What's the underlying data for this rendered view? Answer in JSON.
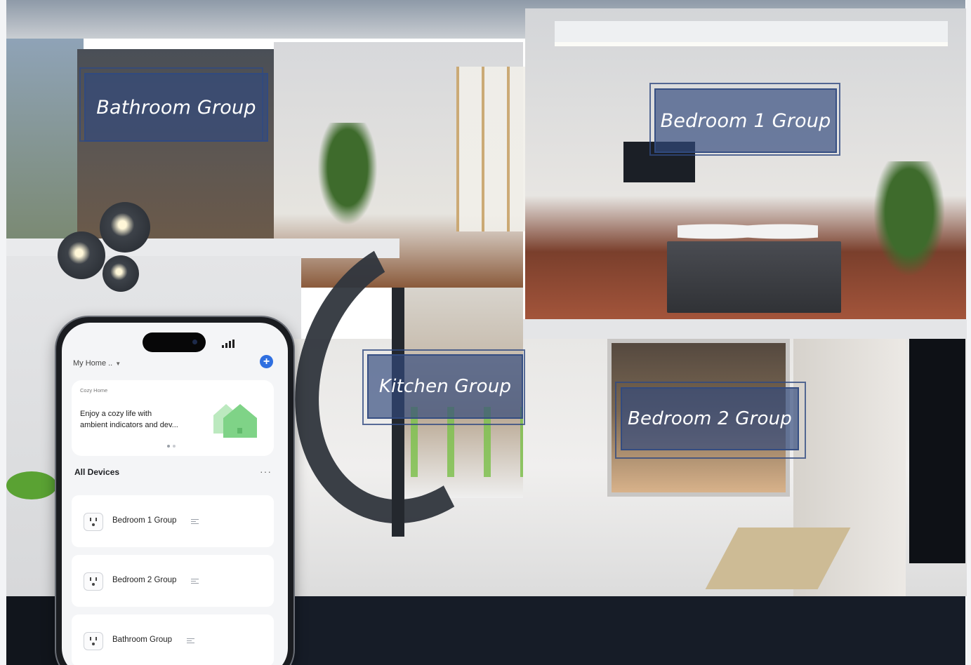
{
  "scene": {
    "labels": {
      "bathroom": "Bathroom Group",
      "bedroom1": "Bedroom 1 Group",
      "kitchen": "Kitchen Group",
      "bedroom2": "Bedroom 2 Group"
    }
  },
  "phone": {
    "home_selector": "My Home ..",
    "add_icon": "plus-circle-icon",
    "banner": {
      "tag": "Cozy Home",
      "text": "Enjoy a cozy life with ambient indicators and dev...",
      "page_count": 2,
      "active_page": 1
    },
    "section_title": "All Devices",
    "more_icon": "···",
    "devices": [
      {
        "name": "Bedroom 1 Group",
        "icon": "smart-plug-icon"
      },
      {
        "name": "Bedroom 2 Group",
        "icon": "smart-plug-icon"
      },
      {
        "name": "Bathroom Group",
        "icon": "smart-plug-icon"
      }
    ]
  },
  "colors": {
    "label_fill": "#32497d",
    "accent": "#2f6fe0",
    "house_icon": "#7fd387"
  }
}
